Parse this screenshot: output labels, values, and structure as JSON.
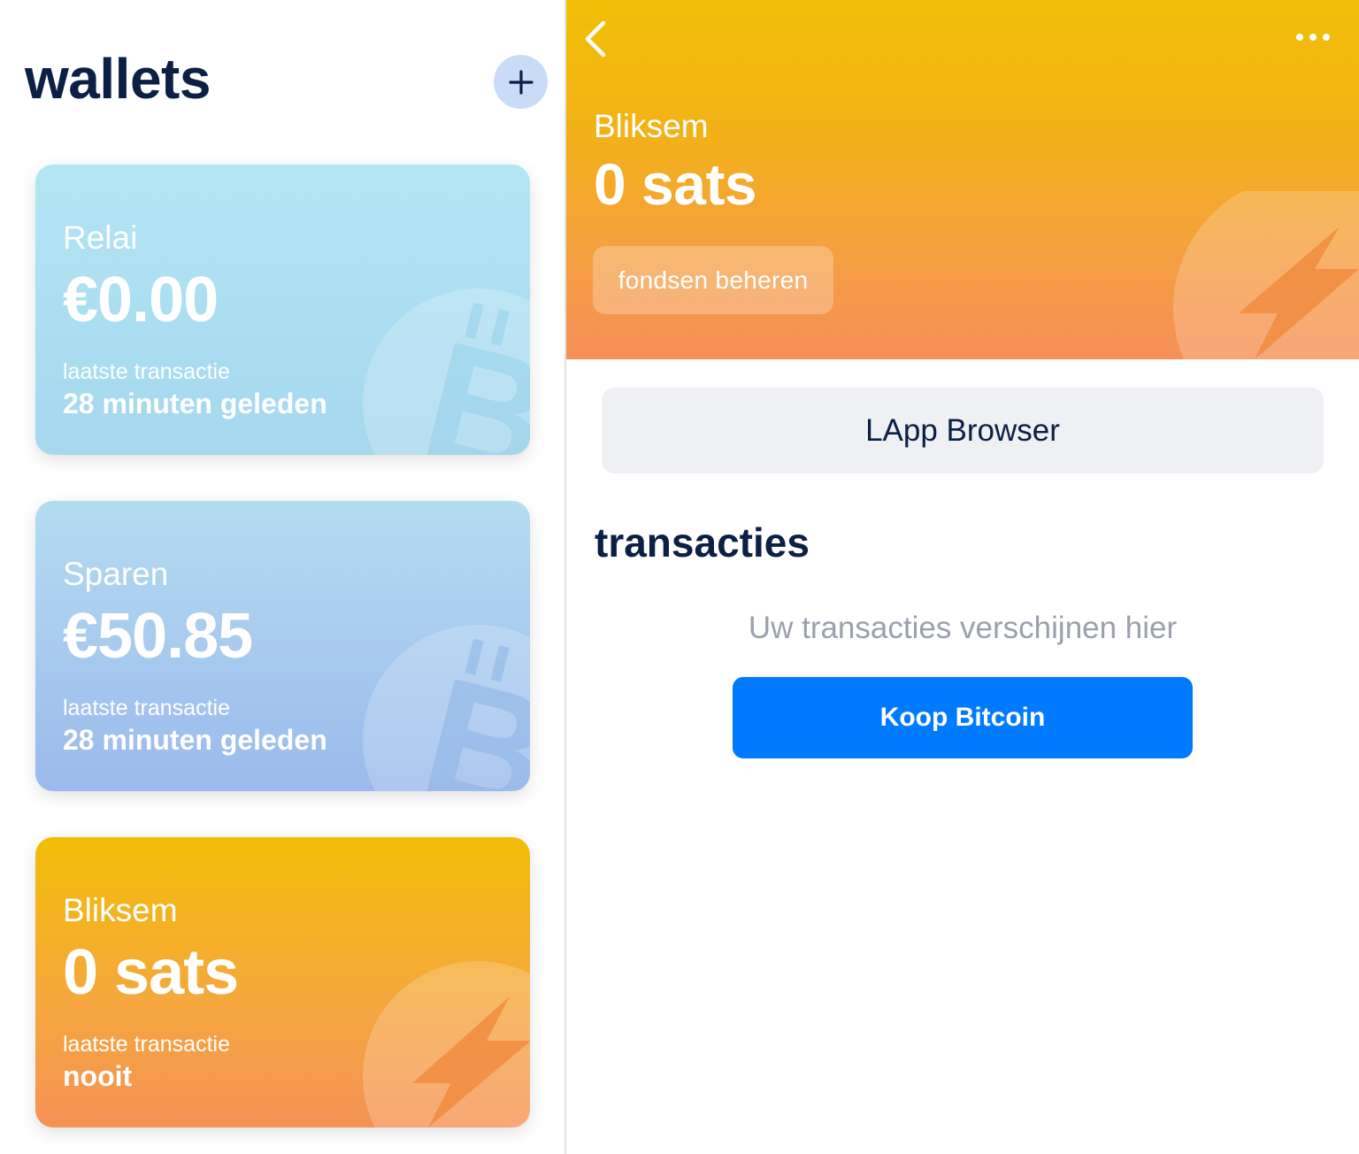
{
  "left": {
    "title": "wallets",
    "add_icon": "plus-icon",
    "wallets": [
      {
        "name": "Relai",
        "balance": "€0.00",
        "last_tx_label": "laatste transactie",
        "last_tx_value": "28 minuten geleden",
        "icon": "bitcoin-icon"
      },
      {
        "name": "Sparen",
        "balance": "€50.85",
        "last_tx_label": "laatste transactie",
        "last_tx_value": "28 minuten geleden",
        "icon": "bitcoin-icon"
      },
      {
        "name": "Bliksem",
        "balance": "0 sats",
        "last_tx_label": "laatste transactie",
        "last_tx_value": "nooit",
        "icon": "lightning-icon"
      }
    ]
  },
  "detail": {
    "header": {
      "back_icon": "chevron-left-icon",
      "more_icon": "more-horizontal-icon",
      "wallet_name": "Bliksem",
      "balance": "0 sats",
      "manage_label": "fondsen beheren",
      "icon": "lightning-icon"
    },
    "lapp_browser_label": "LApp Browser",
    "transactions_title": "transacties",
    "empty_message": "Uw transacties verschijnen hier",
    "buy_label": "Koop Bitcoin"
  },
  "colors": {
    "navy": "#0c1f44",
    "blue_button": "#007aff",
    "lightning_top": "#f1bf06",
    "lightning_bottom": "#f68f57",
    "relai": "#b3e5f5",
    "sparen_top": "#b4dcf1",
    "sparen_bottom": "#9bb9ec"
  }
}
